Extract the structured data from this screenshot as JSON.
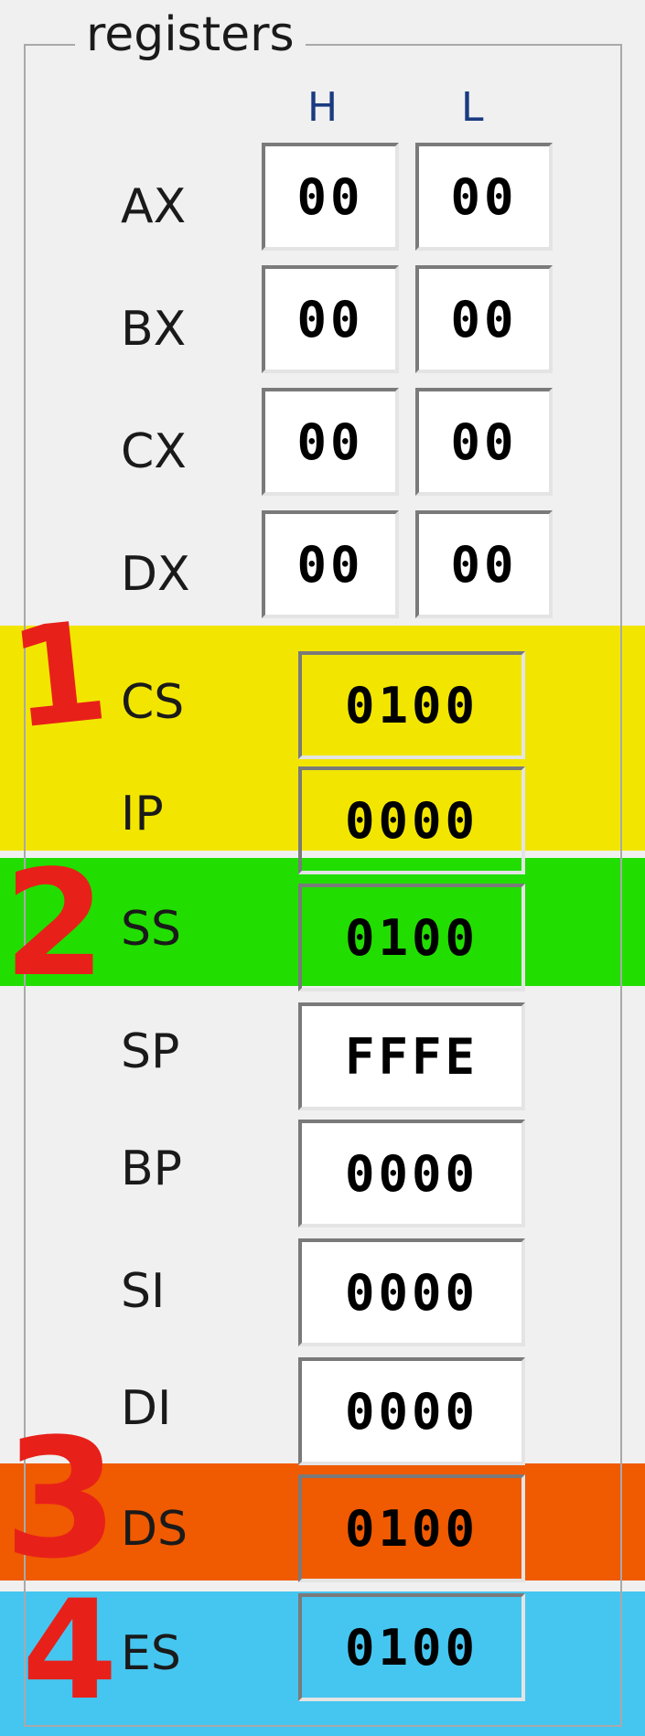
{
  "group": {
    "title": "registers"
  },
  "columns": {
    "high": "H",
    "low": "L"
  },
  "byte_registers": [
    {
      "name": "AX",
      "high": "00",
      "low": "00"
    },
    {
      "name": "BX",
      "high": "00",
      "low": "00"
    },
    {
      "name": "CX",
      "high": "00",
      "low": "00"
    },
    {
      "name": "DX",
      "high": "00",
      "low": "00"
    }
  ],
  "word_registers": [
    {
      "name": "CS",
      "value": "0100",
      "highlight": "#f2e600"
    },
    {
      "name": "IP",
      "value": "0000",
      "highlight": "#f2e600"
    },
    {
      "name": "SS",
      "value": "0100",
      "highlight": "#22dd00"
    },
    {
      "name": "SP",
      "value": "FFFE"
    },
    {
      "name": "BP",
      "value": "0000"
    },
    {
      "name": "SI",
      "value": "0000"
    },
    {
      "name": "DI",
      "value": "0000"
    },
    {
      "name": "DS",
      "value": "0100",
      "highlight": "#f05a00"
    },
    {
      "name": "ES",
      "value": "0100",
      "highlight": "#45c6f0"
    }
  ],
  "annotations": [
    "1",
    "2",
    "3",
    "4"
  ],
  "annotation_color": "#e8201a"
}
